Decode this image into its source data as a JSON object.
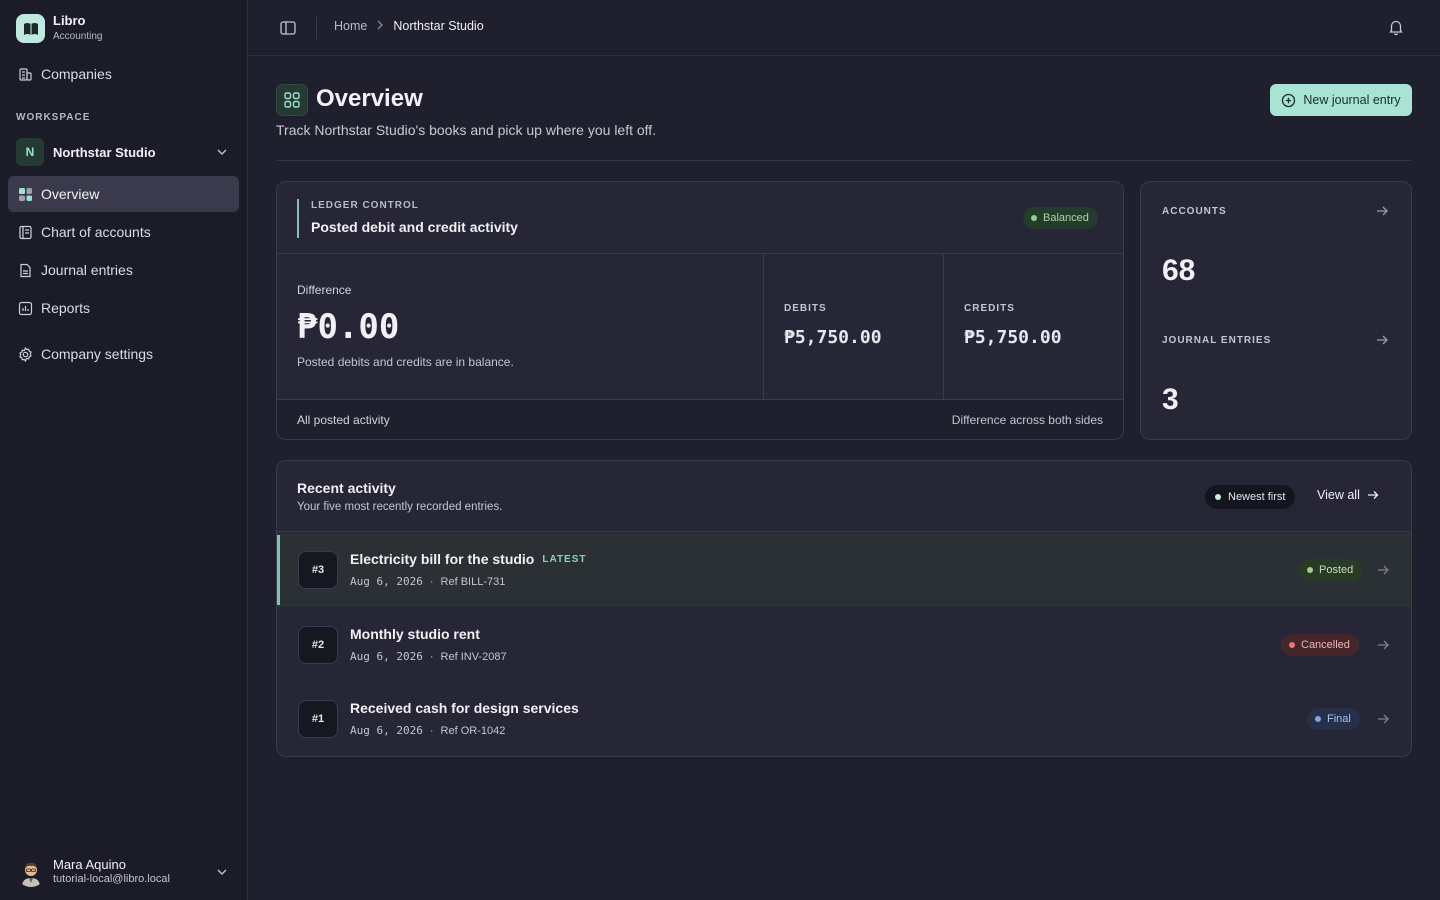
{
  "brand": {
    "name": "Libro",
    "subtitle": "Accounting"
  },
  "sidebar": {
    "companies_label": "Companies",
    "workspace_label": "WORKSPACE",
    "workspace": {
      "initial": "N",
      "name": "Northstar Studio"
    },
    "items": [
      {
        "label": "Overview",
        "icon": "overview-icon",
        "active": true
      },
      {
        "label": "Chart of accounts",
        "icon": "book-icon",
        "active": false
      },
      {
        "label": "Journal entries",
        "icon": "document-icon",
        "active": false
      },
      {
        "label": "Reports",
        "icon": "chart-icon",
        "active": false
      }
    ],
    "settings_label": "Company settings"
  },
  "user": {
    "name": "Mara Aquino",
    "email": "tutorial-local@libro.local"
  },
  "topbar": {
    "breadcrumb": [
      "Home",
      "Northstar Studio"
    ]
  },
  "header": {
    "title": "Overview",
    "subtitle": "Track Northstar Studio's books and pick up where you left off.",
    "new_button": "New journal entry"
  },
  "ledger": {
    "kicker": "LEDGER CONTROL",
    "title": "Posted debit and credit activity",
    "status": "Balanced",
    "difference_label": "Difference",
    "difference_value": "₱0.00",
    "difference_note": "Posted debits and credits are in balance.",
    "debits_label": "DEBITS",
    "debits_value": "₱5,750.00",
    "credits_label": "CREDITS",
    "credits_value": "₱5,750.00",
    "footer_left": "All posted activity",
    "footer_right": "Difference across both sides"
  },
  "stats": {
    "accounts_label": "ACCOUNTS",
    "accounts_value": "68",
    "journal_label": "JOURNAL ENTRIES",
    "journal_value": "3"
  },
  "recent": {
    "title": "Recent activity",
    "subtitle": "Your five most recently recorded entries.",
    "sort_label": "Newest first",
    "view_all": "View all",
    "latest_tag": "LATEST",
    "rows": [
      {
        "num": "#3",
        "title": "Electricity bill for the studio",
        "date": "Aug 6, 2026",
        "ref": "Ref BILL-731",
        "status": "Posted"
      },
      {
        "num": "#2",
        "title": "Monthly studio rent",
        "date": "Aug 6, 2026",
        "ref": "Ref INV-2087",
        "status": "Cancelled"
      },
      {
        "num": "#1",
        "title": "Received cash for design services",
        "date": "Aug 6, 2026",
        "ref": "Ref OR-1042",
        "status": "Final"
      }
    ]
  },
  "colors": {
    "accent": "#a8e3d4",
    "background": "#1f1f2e",
    "posted": "#9ad28a",
    "cancelled": "#e9757d",
    "final": "#7fa3ec"
  }
}
